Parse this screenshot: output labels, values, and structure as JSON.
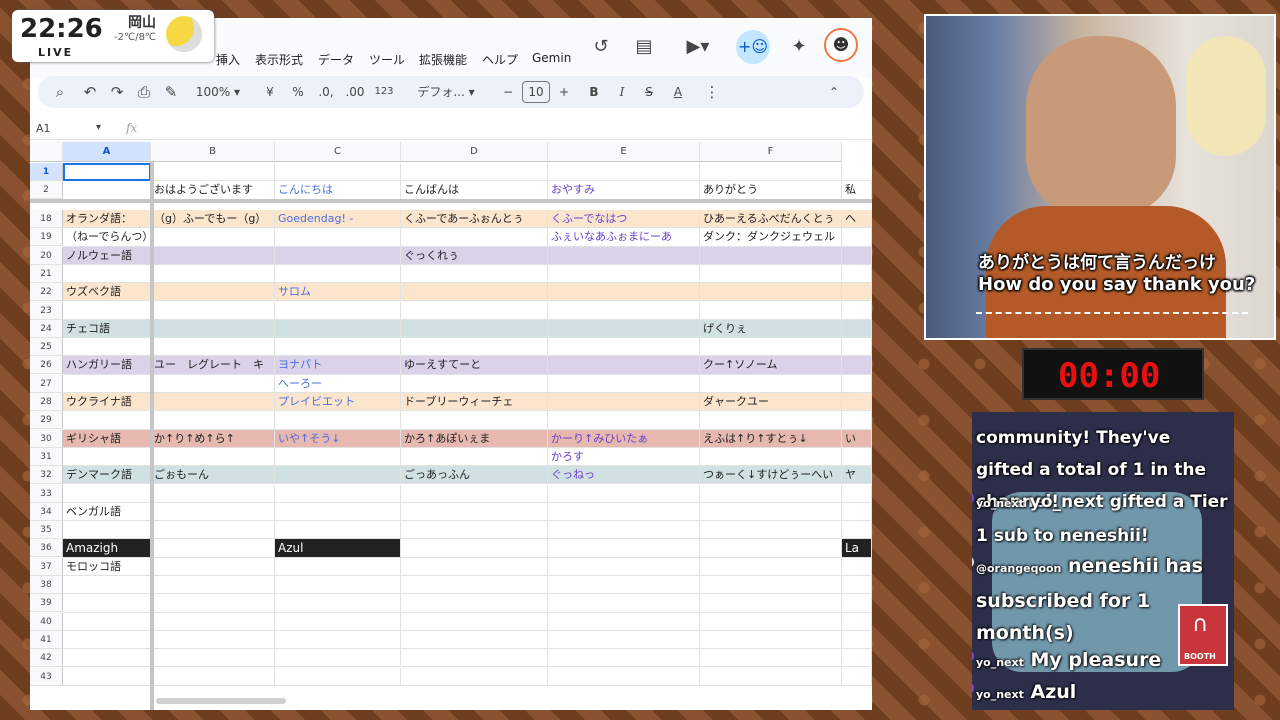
{
  "overlay": {
    "time": "22:26",
    "live": "LIVE",
    "city": "岡山",
    "temp": "-2℃/8℃",
    "timer": "00:00"
  },
  "menus": [
    "挿入",
    "表示形式",
    "データ",
    "ツール",
    "拡張機能",
    "ヘルプ",
    "Gemin"
  ],
  "toolbar": {
    "zoom": "100%",
    "currency": "¥",
    "percent": "%",
    "dec_minus": ".0,",
    "dec_plus": ".00",
    "format123": "123",
    "font": "デフォ...",
    "font_size": "10",
    "minus": "−",
    "plus": "+",
    "bold": "B",
    "italic": "I",
    "strike": "S",
    "textcolor": "A"
  },
  "fx": {
    "cell_ref": "A1",
    "fx_label": "fx"
  },
  "columns": [
    "A",
    "B",
    "C",
    "D",
    "E",
    "F"
  ],
  "rows": [
    {
      "n": "1",
      "cells": [
        "",
        "",
        "",
        "",
        "",
        ""
      ],
      "bg": "#fff",
      "sel": true
    },
    {
      "n": "2",
      "cells": [
        "",
        "おはようございます",
        "こんにちは",
        "こんばんは",
        "おやすみ",
        "ありがとう",
        "私"
      ],
      "bg": "#fff"
    },
    {
      "n": "18",
      "cells": [
        "オランダ語：",
        "（g）ふーでもー（g）",
        "Goedendag! -",
        "くふーであーふぉんとぅ",
        "くふーでなはつ",
        "ひあーえるふべだんくとぅ",
        "ヘ"
      ],
      "bg": "#fce5cd"
    },
    {
      "n": "19",
      "cells": [
        "（ねーでらんつ）",
        "",
        "",
        "",
        "ふぇいなあふぉまにーあ",
        "ダンク：ダンクジェウェル",
        ""
      ],
      "bg": "#fff"
    },
    {
      "n": "20",
      "cells": [
        "ノルウェー語",
        "",
        "",
        "ぐっくれぅ",
        "",
        "",
        ""
      ],
      "bg": "#d9d2e9"
    },
    {
      "n": "21",
      "cells": [
        "",
        "",
        "",
        "",
        "",
        "",
        ""
      ],
      "bg": "#fff"
    },
    {
      "n": "22",
      "cells": [
        "ウズベク語",
        "",
        "サロム",
        "",
        "",
        "",
        ""
      ],
      "bg": "#fce5cd"
    },
    {
      "n": "23",
      "cells": [
        "",
        "",
        "",
        "",
        "",
        "",
        ""
      ],
      "bg": "#fff"
    },
    {
      "n": "24",
      "cells": [
        "チェコ語",
        "",
        "",
        "",
        "",
        "げくりぇ",
        ""
      ],
      "bg": "#d0e0e3"
    },
    {
      "n": "25",
      "cells": [
        "",
        "",
        "",
        "",
        "",
        "",
        ""
      ],
      "bg": "#fff"
    },
    {
      "n": "26",
      "cells": [
        "ハンガリー語",
        "ユー　レグレート　キ",
        "ヨナパト",
        "ゆーえすてーと",
        "",
        "クー↑ソノーム",
        ""
      ],
      "bg": "#d9d2e9"
    },
    {
      "n": "27",
      "cells": [
        "",
        "",
        "へーろー",
        "",
        "",
        "",
        ""
      ],
      "bg": "#fff"
    },
    {
      "n": "28",
      "cells": [
        "ウクライナ語",
        "",
        "プレイビエット",
        "ドーブリーウィーチェ",
        "",
        "ダャークユー",
        ""
      ],
      "bg": "#fce5cd"
    },
    {
      "n": "29",
      "cells": [
        "",
        "",
        "",
        "",
        "",
        "",
        ""
      ],
      "bg": "#fff"
    },
    {
      "n": "30",
      "cells": [
        "ギリシャ語",
        "か↑り↑め↑ら↑",
        "いや↑そう↓",
        "かろ↑あぽいぇま",
        "かーり↑みひいたぁ",
        "えふは↑り↑すとぅ↓",
        "い"
      ],
      "bg": "#e6b8af"
    },
    {
      "n": "31",
      "cells": [
        "",
        "",
        "",
        "",
        "かろす",
        "",
        ""
      ],
      "bg": "#fff"
    },
    {
      "n": "32",
      "cells": [
        "デンマーク語",
        "ごぉもーん",
        "",
        "ごっあっふん",
        "ぐっねっ",
        "つぁーく↓すけどぅーへい",
        "ヤ"
      ],
      "bg": "#d0e0e3"
    },
    {
      "n": "33",
      "cells": [
        "",
        "",
        "",
        "",
        "",
        "",
        ""
      ],
      "bg": "#fff"
    },
    {
      "n": "34",
      "cells": [
        "ベンガル語",
        "",
        "",
        "",
        "",
        "",
        ""
      ],
      "bg": "#fff"
    },
    {
      "n": "35",
      "cells": [
        "",
        "",
        "",
        "",
        "",
        "",
        ""
      ],
      "bg": "#fff"
    },
    {
      "n": "36",
      "cells": [
        "Amazigh",
        "",
        "Azul",
        "",
        "",
        "",
        "La"
      ],
      "bg": "#fff",
      "dark": [
        0,
        2,
        6
      ]
    },
    {
      "n": "37",
      "cells": [
        "モロッコ語",
        "",
        "",
        "",
        "",
        "",
        ""
      ],
      "bg": "#fff"
    },
    {
      "n": "38",
      "cells": [
        "",
        "",
        "",
        "",
        "",
        "",
        ""
      ],
      "bg": "#fff"
    },
    {
      "n": "39",
      "cells": [
        "",
        "",
        "",
        "",
        "",
        "",
        ""
      ],
      "bg": "#fff"
    },
    {
      "n": "40",
      "cells": [
        "",
        "",
        "",
        "",
        "",
        "",
        ""
      ],
      "bg": "#fff"
    },
    {
      "n": "41",
      "cells": [
        "",
        "",
        "",
        "",
        "",
        "",
        ""
      ],
      "bg": "#fff"
    },
    {
      "n": "42",
      "cells": [
        "",
        "",
        "",
        "",
        "",
        "",
        ""
      ],
      "bg": "#fff"
    },
    {
      "n": "43",
      "cells": [
        "",
        "",
        "",
        "",
        "",
        "",
        ""
      ],
      "bg": "#fff"
    }
  ],
  "caption": {
    "jp": "ありがとうは何て言うんだっけ",
    "en": "How do you say thank you?"
  },
  "chat": [
    {
      "user": "",
      "text": "community! They've gifted a total of 1 in the channel!"
    },
    {
      "user": "yo_next",
      "text": "yo_next gifted a Tier 1 sub to neneshii!"
    },
    {
      "user": "@orangeqoon",
      "text": "neneshii has subscribed for 1 month(s)"
    },
    {
      "user": "yo_next",
      "text": "My pleasure"
    },
    {
      "user": "yo_next",
      "text": "Azul"
    }
  ],
  "booth_label": "BOOTH",
  "colors": {
    "accent": "#0b57d0",
    "blue_text": "#4a6ee0",
    "purple_text": "#6a3fd4"
  }
}
